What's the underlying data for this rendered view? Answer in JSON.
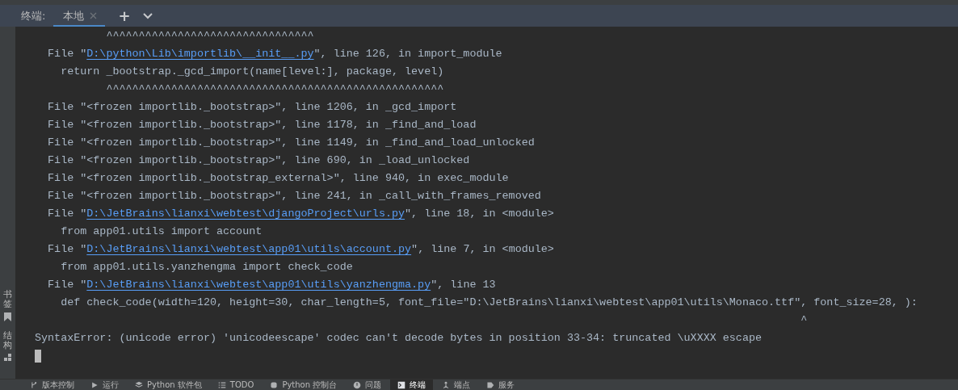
{
  "terminal_header": {
    "label": "终端:",
    "tabs": [
      {
        "label": "本地",
        "selected": true
      }
    ],
    "add_button": "+"
  },
  "side_tabs": [
    {
      "label": "书签"
    },
    {
      "label": "结构"
    }
  ],
  "lines": [
    {
      "kind": "caret",
      "text": "           ^^^^^^^^^^^^^^^^^^^^^^^^^^^^^^^^"
    },
    {
      "kind": "frame",
      "before": "  File \"",
      "link": "D:\\python\\Lib\\importlib\\__init__.py",
      "after": "\", line 126, in import_module"
    },
    {
      "kind": "code",
      "text": "    return _bootstrap._gcd_import(name[level:], package, level)"
    },
    {
      "kind": "caret",
      "text": "           ^^^^^^^^^^^^^^^^^^^^^^^^^^^^^^^^^^^^^^^^^^^^^^^^^^^^"
    },
    {
      "kind": "frame",
      "before": "  File \"<frozen importlib._bootstrap>\", line 1206, in _gcd_import"
    },
    {
      "kind": "frame",
      "before": "  File \"<frozen importlib._bootstrap>\", line 1178, in _find_and_load"
    },
    {
      "kind": "frame",
      "before": "  File \"<frozen importlib._bootstrap>\", line 1149, in _find_and_load_unlocked"
    },
    {
      "kind": "frame",
      "before": "  File \"<frozen importlib._bootstrap>\", line 690, in _load_unlocked"
    },
    {
      "kind": "frame",
      "before": "  File \"<frozen importlib._bootstrap_external>\", line 940, in exec_module"
    },
    {
      "kind": "frame",
      "before": "  File \"<frozen importlib._bootstrap>\", line 241, in _call_with_frames_removed"
    },
    {
      "kind": "frame",
      "before": "  File \"",
      "link": "D:\\JetBrains\\lianxi\\webtest\\djangoProject\\urls.py",
      "after": "\", line 18, in <module>"
    },
    {
      "kind": "code",
      "text": "    from app01.utils import account"
    },
    {
      "kind": "frame",
      "before": "  File \"",
      "link": "D:\\JetBrains\\lianxi\\webtest\\app01\\utils\\account.py",
      "after": "\", line 7, in <module>"
    },
    {
      "kind": "code",
      "text": "    from app01.utils.yanzhengma import check_code"
    },
    {
      "kind": "frame",
      "before": "  File \"",
      "link": "D:\\JetBrains\\lianxi\\webtest\\app01\\utils\\yanzhengma.py",
      "after": "\", line 13"
    },
    {
      "kind": "code",
      "text": "    def check_code(width=120, height=30, char_length=5, font_file=\"D:\\JetBrains\\lianxi\\webtest\\app01\\utils\\Monaco.ttf\", font_size=28, ):"
    },
    {
      "kind": "caret",
      "text": "                                                                                                                      ^"
    },
    {
      "kind": "error",
      "text": "SyntaxError: (unicode error) 'unicodeescape' codec can't decode bytes in position 33-34: truncated \\uXXXX escape"
    }
  ],
  "tool_windows": [
    {
      "label": "版本控制",
      "selected": false
    },
    {
      "label": "运行",
      "selected": false
    },
    {
      "label": "Python 软件包",
      "selected": false
    },
    {
      "label": "TODO",
      "selected": false
    },
    {
      "label": "Python 控制台",
      "selected": false
    },
    {
      "label": "问题",
      "selected": false
    },
    {
      "label": "终端",
      "selected": true
    },
    {
      "label": "端点",
      "selected": false
    },
    {
      "label": "服务",
      "selected": false
    }
  ]
}
